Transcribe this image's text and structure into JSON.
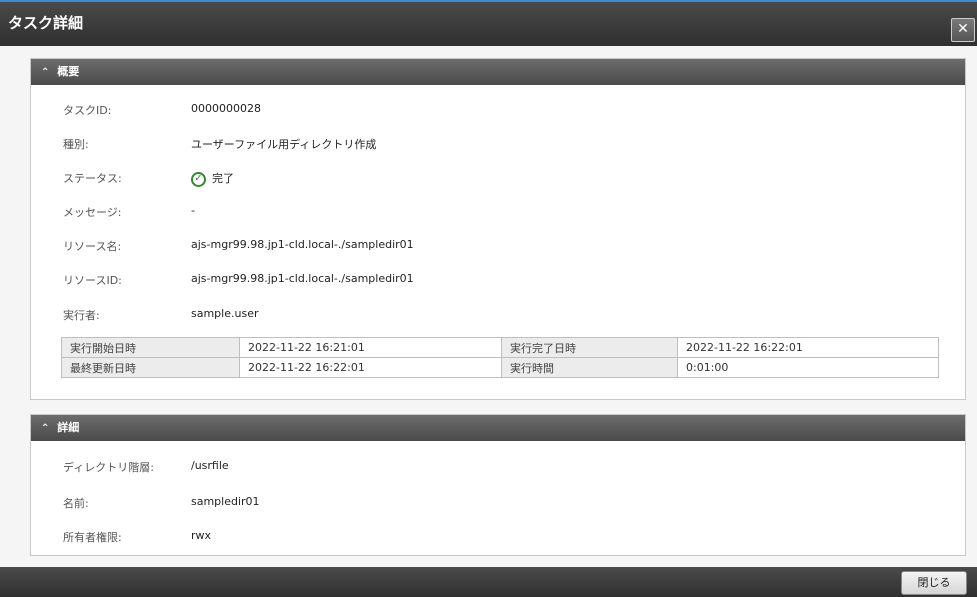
{
  "dialog": {
    "title": "タスク詳細",
    "close_label": "✕"
  },
  "overview": {
    "header": "概要",
    "fields": [
      {
        "label": "タスクID:",
        "value": "0000000028"
      },
      {
        "label": "種別:",
        "value": "ユーザーファイル用ディレクトリ作成"
      },
      {
        "label": "ステータス:",
        "value": "完了"
      },
      {
        "label": "メッセージ:",
        "value": "-"
      },
      {
        "label": "リソース名:",
        "value": "ajs-mgr99.98.jp1-cld.local-./sampledir01"
      },
      {
        "label": "リソースID:",
        "value": "ajs-mgr99.98.jp1-cld.local-./sampledir01"
      },
      {
        "label": "実行者:",
        "value": "sample.user"
      }
    ],
    "table": [
      [
        "実行開始日時",
        "2022-11-22 16:21:01",
        "実行完了日時",
        "2022-11-22 16:22:01"
      ],
      [
        "最終更新日時",
        "2022-11-22 16:22:01",
        "実行時間",
        "0:01:00"
      ]
    ]
  },
  "details": {
    "header": "詳細",
    "fields": [
      {
        "label": "ディレクトリ階層:",
        "value": "/usrfile"
      },
      {
        "label": "名前:",
        "value": "sampledir01"
      },
      {
        "label": "所有者権限:",
        "value": "rwx"
      }
    ]
  },
  "footer": {
    "close_button": "閉じる"
  },
  "colors": {
    "status_ok": "#2e8b2e",
    "title_bar": "#3a3a3a"
  },
  "icons": {
    "status": "check-circle-icon",
    "collapse": "chevron-up-icon"
  }
}
